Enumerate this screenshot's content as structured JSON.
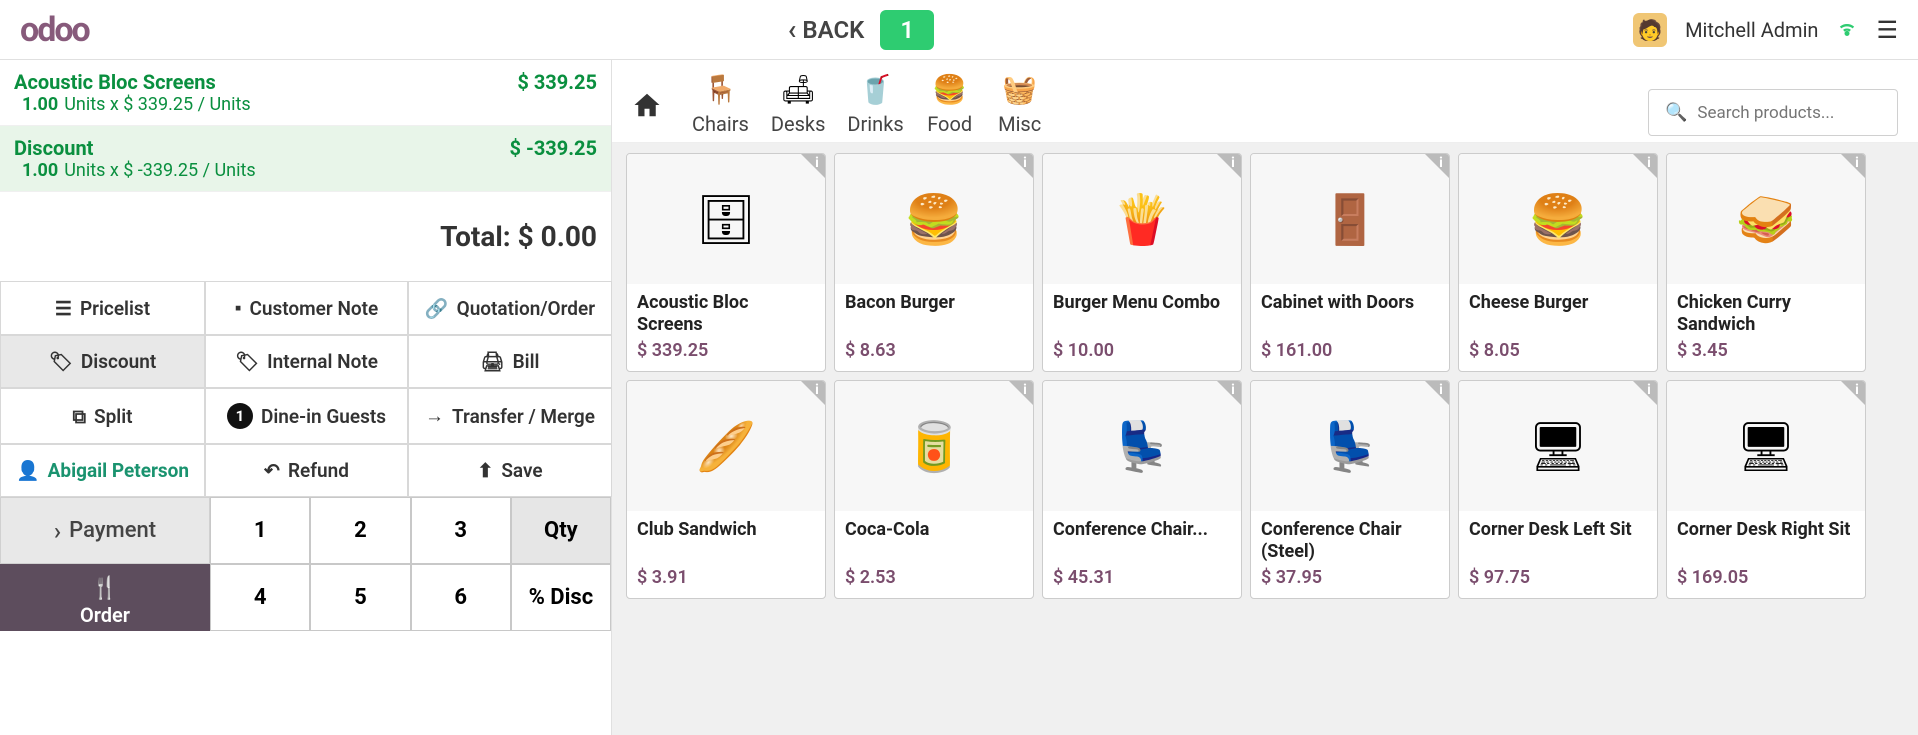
{
  "topbar": {
    "logo": "odoo",
    "back_label": "BACK",
    "table_number": "1",
    "username": "Mitchell Admin"
  },
  "order_lines": [
    {
      "name": "Acoustic Bloc Screens",
      "qty": "1.00",
      "unit_label": "Units x $ 339.25 / Units",
      "price": "$ 339.25",
      "selected": false
    },
    {
      "name": "Discount",
      "qty": "1.00",
      "unit_label": "Units x $ -339.25 / Units",
      "price": "$ -339.25",
      "selected": true
    }
  ],
  "total_label": "Total: $ 0.00",
  "actions": {
    "pricelist": "Pricelist",
    "customer_note": "Customer Note",
    "quotation": "Quotation/Order",
    "discount": "Discount",
    "internal_note": "Internal Note",
    "bill": "Bill",
    "split": "Split",
    "guests": "Dine-in Guests",
    "guest_count": "1",
    "transfer": "Transfer / Merge",
    "customer": "Abigail Peterson",
    "refund": "Refund",
    "save": "Save",
    "payment": "Payment",
    "order_tab": "Order"
  },
  "numpad": {
    "r1": [
      "1",
      "2",
      "3",
      "Qty"
    ],
    "r2": [
      "4",
      "5",
      "6",
      "% Disc"
    ]
  },
  "categories": [
    {
      "label": "Chairs",
      "icon": "🪑"
    },
    {
      "label": "Desks",
      "icon": "🛋"
    },
    {
      "label": "Drinks",
      "icon": "🥤"
    },
    {
      "label": "Food",
      "icon": "🍔"
    },
    {
      "label": "Misc",
      "icon": "🧺"
    }
  ],
  "search": {
    "placeholder": "Search products..."
  },
  "products": [
    {
      "name": "Acoustic Bloc Screens",
      "price": "$ 339.25",
      "emoji": "🗄"
    },
    {
      "name": "Bacon Burger",
      "price": "$ 8.63",
      "emoji": "🍔"
    },
    {
      "name": "Burger Menu Combo",
      "price": "$ 10.00",
      "emoji": "🍟"
    },
    {
      "name": "Cabinet with Doors",
      "price": "$ 161.00",
      "emoji": "🚪"
    },
    {
      "name": "Cheese Burger",
      "price": "$ 8.05",
      "emoji": "🍔"
    },
    {
      "name": "Chicken Curry Sandwich",
      "price": "$ 3.45",
      "emoji": "🥪"
    },
    {
      "name": "Club Sandwich",
      "price": "$ 3.91",
      "emoji": "🥖"
    },
    {
      "name": "Coca-Cola",
      "price": "$ 2.53",
      "emoji": "🥫"
    },
    {
      "name": "Conference Chair...",
      "price": "$ 45.31",
      "emoji": "💺"
    },
    {
      "name": "Conference Chair (Steel)",
      "price": "$ 37.95",
      "emoji": "💺"
    },
    {
      "name": "Corner Desk Left Sit",
      "price": "$ 97.75",
      "emoji": "🖥"
    },
    {
      "name": "Corner Desk Right Sit",
      "price": "$ 169.05",
      "emoji": "🖥"
    }
  ]
}
